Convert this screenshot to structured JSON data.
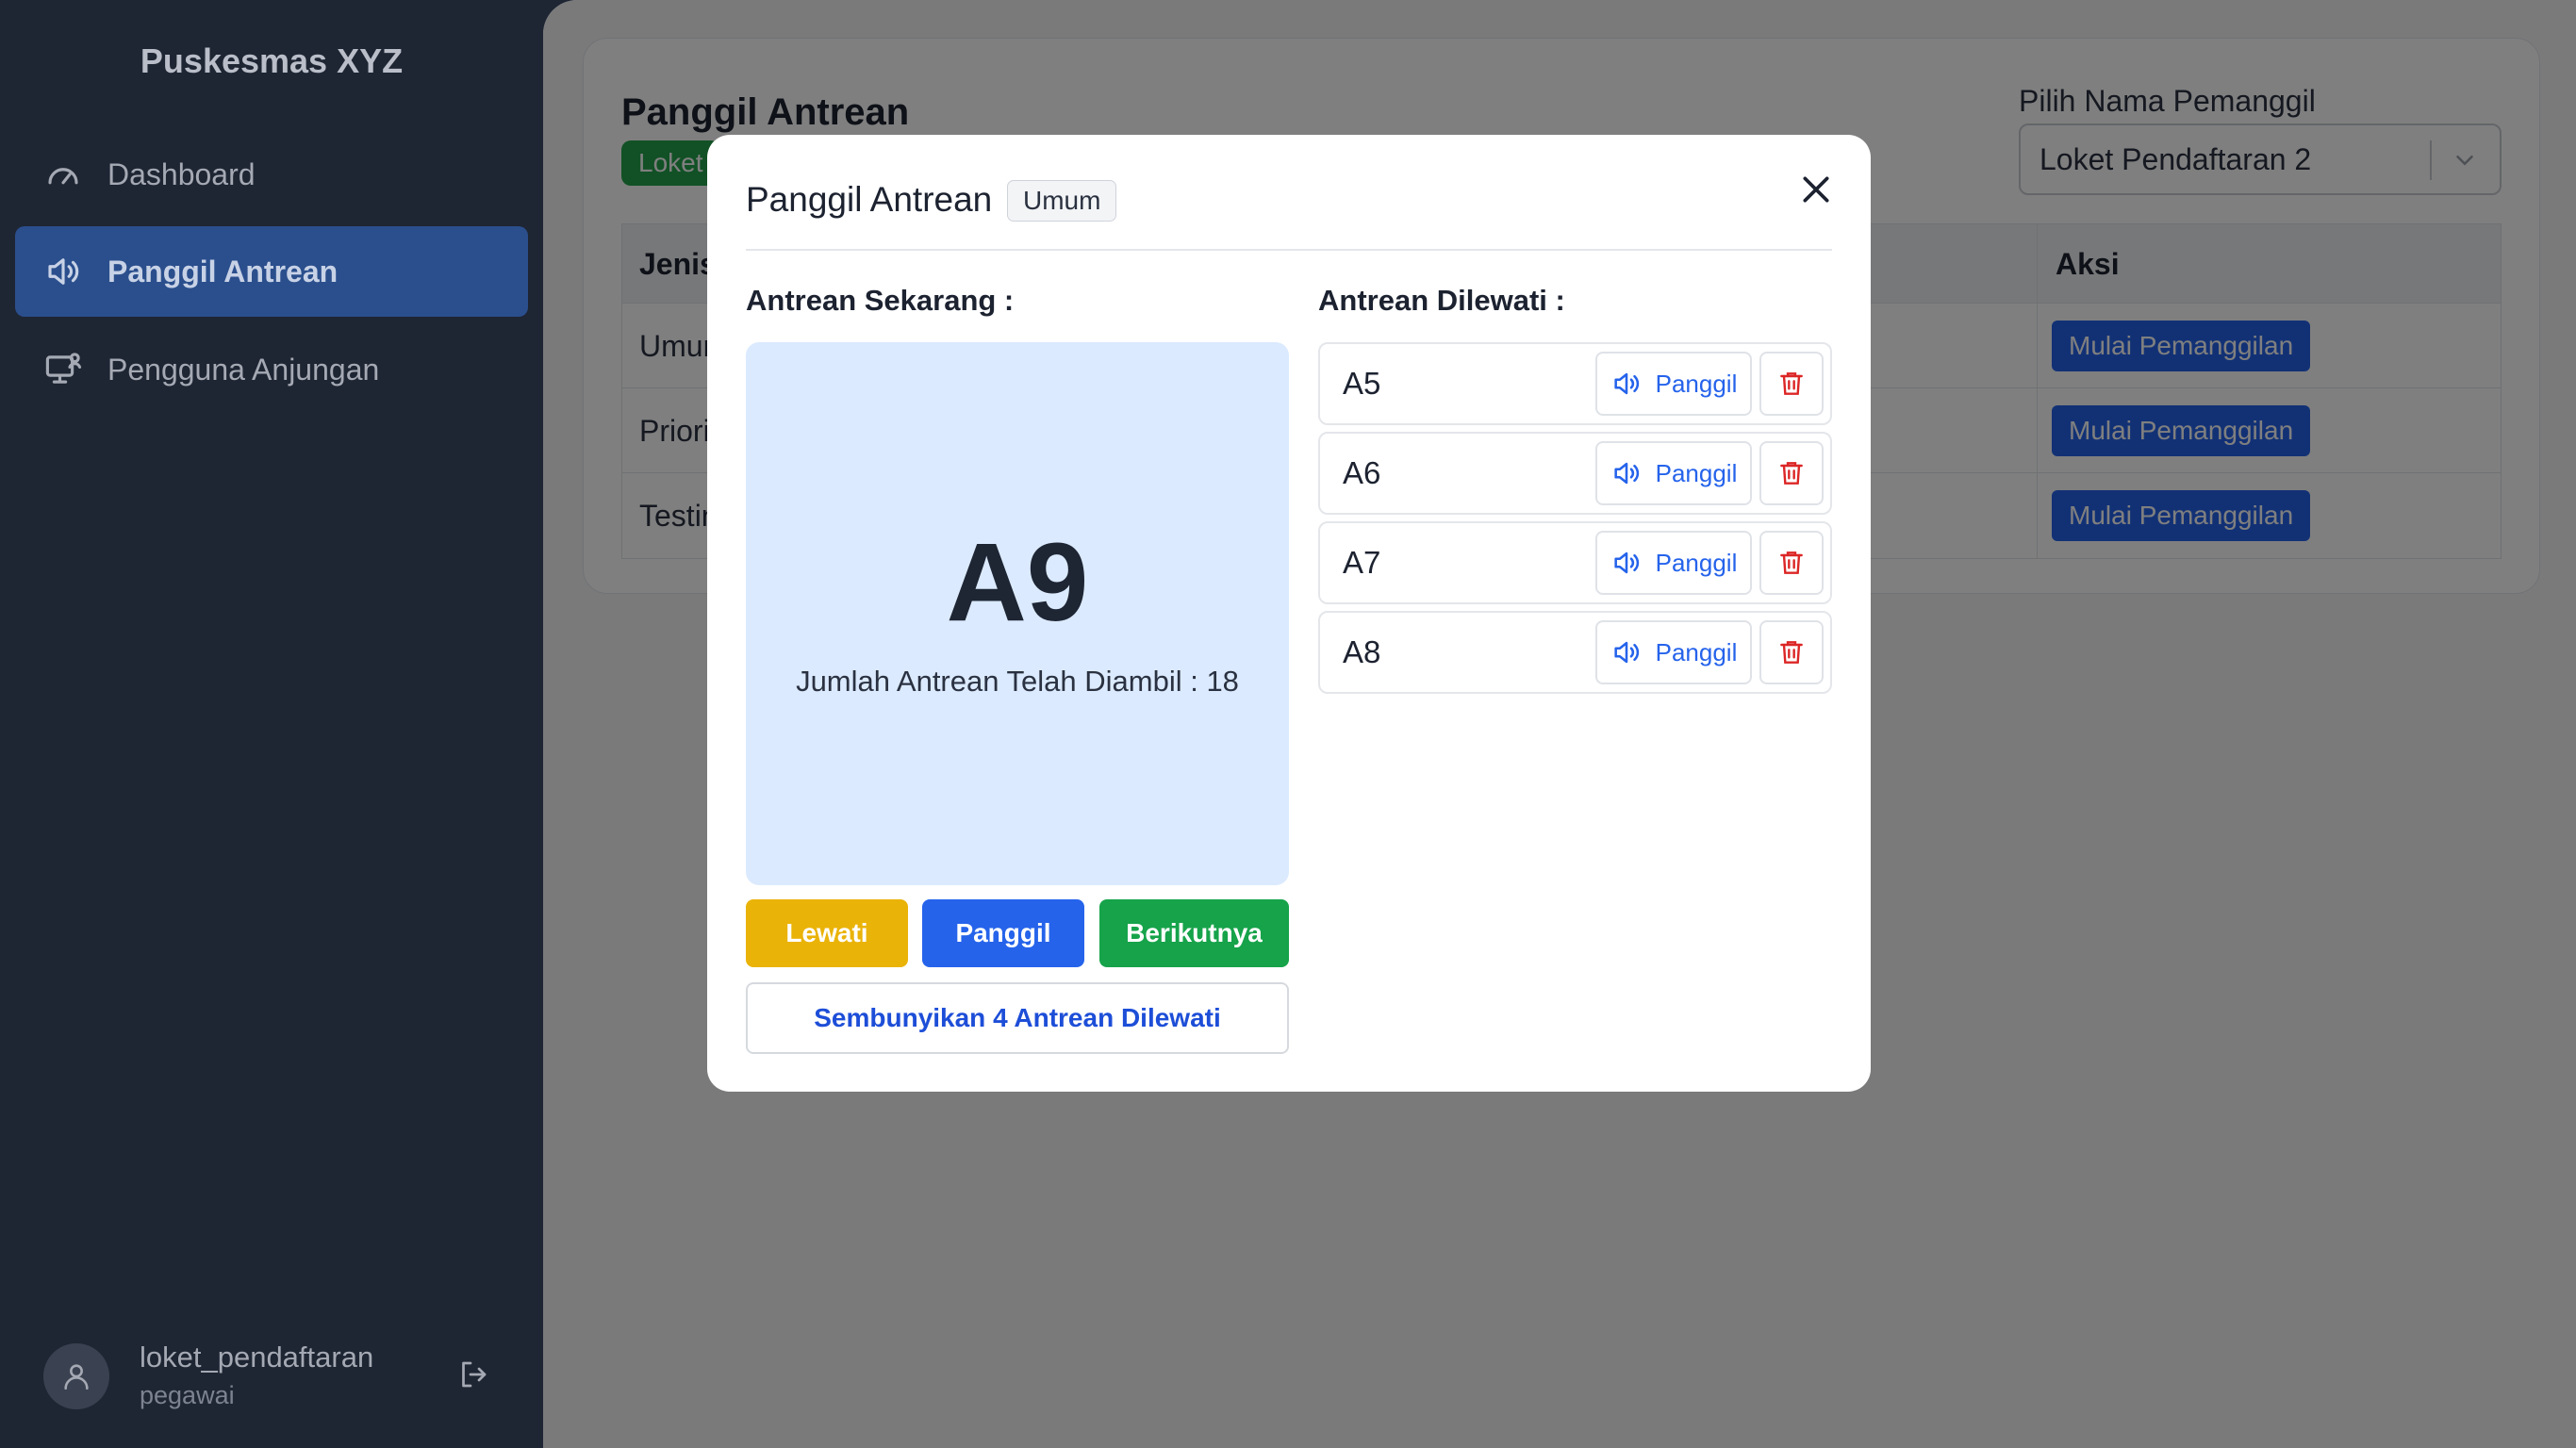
{
  "sidebar": {
    "brand": "Puskesmas XYZ",
    "items": [
      {
        "label": "Dashboard",
        "icon": "gauge-icon"
      },
      {
        "label": "Panggil Antrean",
        "icon": "speaker-icon",
        "active": true
      },
      {
        "label": "Pengguna Anjungan",
        "icon": "monitor-user-icon"
      }
    ],
    "user": {
      "name": "loket_pendaftaran",
      "role": "pegawai"
    }
  },
  "page": {
    "title": "Panggil Antrean",
    "badge": "Loket",
    "picker_label": "Pilih Nama Pemanggil",
    "picker_value": "Loket Pendaftaran 2",
    "table": {
      "headers": [
        "Jenis",
        "Aksi"
      ],
      "rows": [
        {
          "jenis": "Umum",
          "action": "Mulai Pemanggilan"
        },
        {
          "jenis": "Priori",
          "action": "Mulai Pemanggilan"
        },
        {
          "jenis": "Testin",
          "action": "Mulai Pemanggilan"
        }
      ]
    }
  },
  "modal": {
    "title": "Panggil Antrean",
    "category": "Umum",
    "current_label": "Antrean Sekarang :",
    "current_number": "A9",
    "taken_count": "Jumlah Antrean Telah Diambil : 18",
    "buttons": {
      "skip": "Lewati",
      "call": "Panggil",
      "next": "Berikutnya"
    },
    "hide_skipped": "Sembunyikan 4 Antrean Dilewati",
    "skipped_label": "Antrean Dilewati :",
    "skipped": [
      {
        "code": "A5",
        "call": "Panggil"
      },
      {
        "code": "A6",
        "call": "Panggil"
      },
      {
        "code": "A7",
        "call": "Panggil"
      },
      {
        "code": "A8",
        "call": "Panggil"
      }
    ]
  },
  "colors": {
    "sidebar_bg": "#1e2533",
    "active_nav": "#2b4f8d",
    "primary": "#2563eb",
    "warning": "#eab308",
    "success": "#16a34a",
    "danger": "#dc2626",
    "current_box": "#dbeafe"
  }
}
